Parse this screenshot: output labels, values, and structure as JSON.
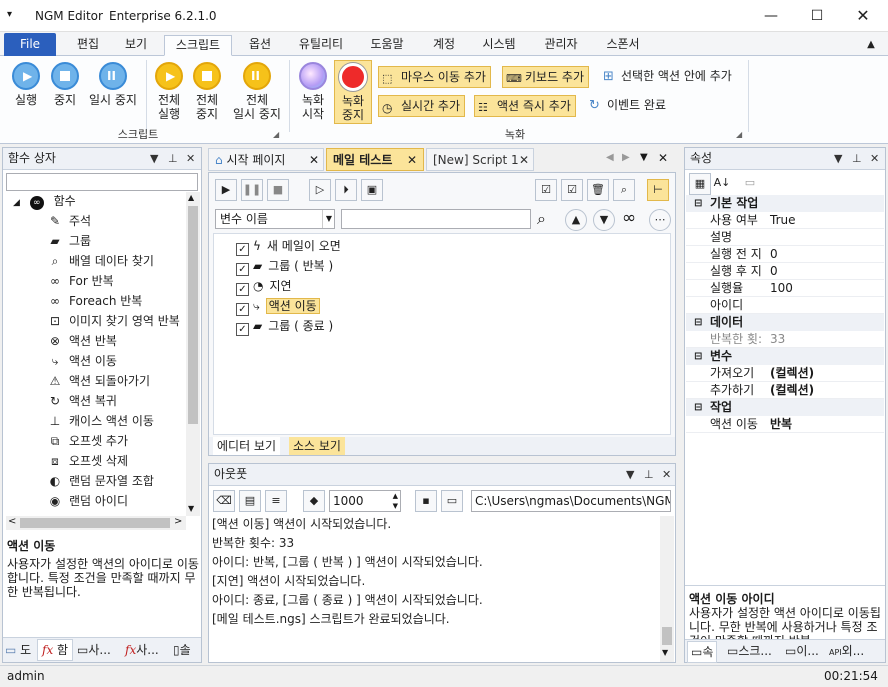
{
  "app": {
    "menu_glyph": "▾",
    "name": "NGM Editor",
    "edition": "Enterprise 6.2.1.0"
  },
  "tabs": [
    "File",
    "편집",
    "보기",
    "스크립트",
    "옵션",
    "유틸리티",
    "도움말",
    "계정",
    "시스템",
    "관리자",
    "스폰서"
  ],
  "ribbon": {
    "script_buttons": [
      {
        "label": "실행",
        "icon": "play-icon"
      },
      {
        "label": "중지",
        "icon": "stop-icon"
      },
      {
        "label": "일시 중지",
        "icon": "pause-icon"
      },
      {
        "label1": "전체",
        "label2": "실행",
        "icon": "play-all-icon"
      },
      {
        "label1": "전체",
        "label2": "중지",
        "icon": "stop-all-icon"
      },
      {
        "label1": "전체",
        "label2": "일시 중지",
        "icon": "pause-all-icon"
      }
    ],
    "script_group": "스크립트",
    "record_start": {
      "l1": "녹화",
      "l2": "시작"
    },
    "record_stop": {
      "l1": "녹화",
      "l2": "중지"
    },
    "record_actions": [
      "마우스 이동 추가",
      "키보드 추가",
      "선택한 액션 안에 추가",
      "실시간 추가",
      "액션 즉시 추가",
      "이벤트 완료"
    ],
    "record_group": "녹화"
  },
  "left_panel": {
    "title": "함수 상자",
    "root": "함수",
    "items": [
      {
        "label": "주석",
        "icon": "comment-icon"
      },
      {
        "label": "그룹",
        "icon": "group-icon"
      },
      {
        "label": "배열 데이타 찾기",
        "icon": "search-icon"
      },
      {
        "label": "For 반복",
        "icon": "infinity-icon"
      },
      {
        "label": "Foreach 반복",
        "icon": "infinity-icon"
      },
      {
        "label": "이미지 찾기 영역 반복",
        "icon": "image-search-icon"
      },
      {
        "label": "액션 반복",
        "icon": "repeat-icon"
      },
      {
        "label": "액션 이동",
        "icon": "jump-icon"
      },
      {
        "label": "액션 되돌아가기",
        "icon": "return-icon"
      },
      {
        "label": "액션 복귀",
        "icon": "restore-icon"
      },
      {
        "label": "캐이스 액션 이동",
        "icon": "case-icon"
      },
      {
        "label": "오프셋 추가",
        "icon": "offset-add-icon"
      },
      {
        "label": "오프셋 삭제",
        "icon": "offset-delete-icon"
      },
      {
        "label": "랜덤 문자열 조합",
        "icon": "random-string-icon"
      },
      {
        "label": "랜덤 아이디",
        "icon": "random-id-icon"
      }
    ],
    "desc_title": "액션 이동",
    "desc_text": "사용자가 설정한 액션의 아이디로 이동합니다. 특정 조건을 만족할 때까지 무한 반복됩니다.",
    "bottom_tabs": [
      "도",
      "함",
      "사...",
      "사...",
      "솔"
    ]
  },
  "editor": {
    "tabs": [
      "시작 페이지",
      "메일 테스트",
      "[New] Script 1"
    ],
    "filter_select": "변수 이름",
    "filter_input": "",
    "rows": [
      {
        "label": "새 메일이 오면",
        "icon": "lightning-icon"
      },
      {
        "label": "그룹 ( 반복 )",
        "icon": "group-icon"
      },
      {
        "label": "지연",
        "icon": "timer-icon"
      },
      {
        "label": "액션 이동",
        "icon": "jump-icon"
      },
      {
        "label": "그룹 ( 종료 )",
        "icon": "group-icon"
      }
    ],
    "bottom_tabs": [
      "에디터 보기",
      "소스 보기"
    ]
  },
  "output": {
    "title": "아웃풋",
    "interval": "1000",
    "path": "C:\\Users\\ngmas\\Documents\\NGM6\\",
    "lines": [
      "[액션 이동] 액션이 시작되었습니다.",
      "반복한 횟수: 33",
      "아이디: 반복, [그룹 ( 반복 ) ] 액션이 시작되었습니다.",
      "[지연] 액션이 시작되었습니다.",
      "아이디: 종료, [그룹 ( 종료 ) ] 액션이 시작되었습니다.",
      "[메일 테스트.ngs] 스크립트가 완료되었습니다."
    ]
  },
  "properties": {
    "title": "속성",
    "cat_basic": "기본 작업",
    "use_k": "사용 여부",
    "use_v": "True",
    "desc_k": "설명",
    "before_k": "실행 전 지",
    "before_v": "0",
    "after_k": "실행 후 지",
    "after_v": "0",
    "rate_k": "실행율",
    "rate_v": "100",
    "id_k": "아이디",
    "cat_data": "데이터",
    "repeat_k": "반복한 횟:",
    "repeat_v": "33",
    "cat_var": "변수",
    "get_k": "가져오기",
    "get_v": "(컬렉션)",
    "add_k": "추가하기",
    "add_v": "(컬렉션)",
    "cat_action": "작업",
    "move_k": "액션 이동",
    "move_v": "반복",
    "desc_title": "액션 이동 아이디",
    "desc_text": "사용자가 설정한 액션 아이디로 이동됩니다. 무한 반복에 사용하거나 특정 조건이 만족할 때까지 반복...",
    "bottom_tabs": [
      "속",
      "스크...",
      "이...",
      "외..."
    ]
  },
  "status": {
    "user": "admin",
    "time": "00:21:54"
  }
}
